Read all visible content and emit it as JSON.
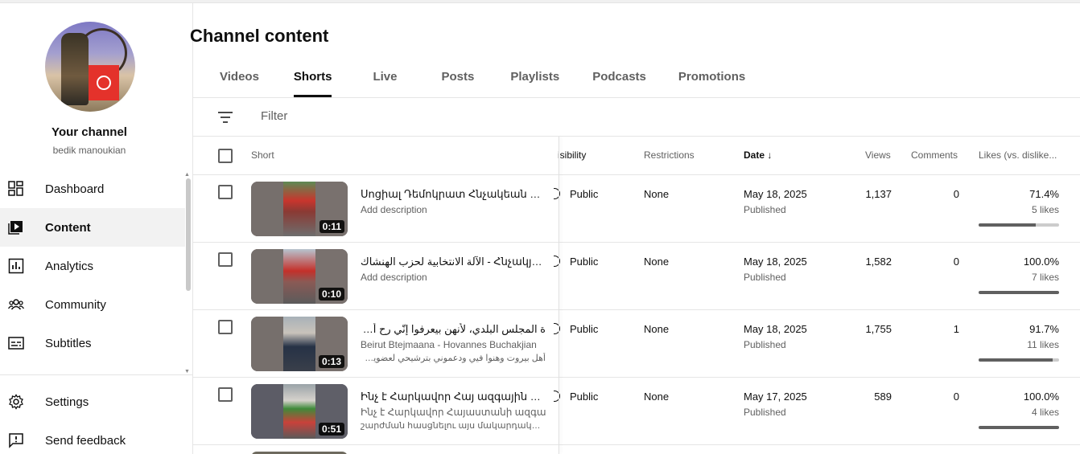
{
  "sidebar": {
    "channel_title": "Your channel",
    "channel_handle": "bedik manoukian",
    "items": [
      {
        "label": "Dashboard",
        "icon": "dashboard-icon"
      },
      {
        "label": "Content",
        "icon": "content-icon",
        "active": true
      },
      {
        "label": "Analytics",
        "icon": "analytics-icon"
      },
      {
        "label": "Community",
        "icon": "community-icon"
      },
      {
        "label": "Subtitles",
        "icon": "subtitles-icon"
      }
    ],
    "bottom_items": [
      {
        "label": "Settings",
        "icon": "gear-icon"
      },
      {
        "label": "Send feedback",
        "icon": "feedback-icon"
      }
    ]
  },
  "main": {
    "title": "Channel content",
    "tabs": [
      {
        "label": "Videos"
      },
      {
        "label": "Shorts",
        "active": true
      },
      {
        "label": "Live"
      },
      {
        "label": "Posts"
      },
      {
        "label": "Playlists"
      },
      {
        "label": "Podcasts"
      },
      {
        "label": "Promotions"
      }
    ],
    "filter_placeholder": "Filter",
    "columns": {
      "short": "Short",
      "visibility": "isibility",
      "restrictions": "Restrictions",
      "date": "Date",
      "date_sort": "↓",
      "views": "Views",
      "comments": "Comments",
      "likes": "Likes (vs. dislike..."
    },
    "rows": [
      {
        "duration": "0:11",
        "title": "Սոցիալ Դեմոկրատ Հնչակեան կուս...",
        "description": "Add description",
        "description2": "",
        "visibility": "Public",
        "restrictions": "None",
        "date": "May 18, 2025",
        "status": "Published",
        "views": "1,137",
        "comments": "0",
        "likes_pct": "71.4%",
        "likes_count": "5 likes",
        "likes_ratio": 0.714
      },
      {
        "duration": "0:10",
        "title": "الآلة الانتخابية لحزب الهنشاك - Հնչակյան կուս...",
        "description": "Add description",
        "description2": "",
        "visibility": "Public",
        "restrictions": "None",
        "date": "May 18, 2025",
        "status": "Published",
        "views": "1,582",
        "comments": "0",
        "likes_pct": "100.0%",
        "likes_count": "7 likes",
        "likes_ratio": 1.0
      },
      {
        "duration": "0:13",
        "title": "ة المجلس البلدي، لأنهن بيعرفوا إنّي رح أوصّل صوتن",
        "description": "Beirut Btejmaana - Hovannes Buchakjian",
        "description2": "أهل بيروت وهنوا فيي ودعموني بترشيحي لعضوية اا...",
        "visibility": "Public",
        "restrictions": "None",
        "date": "May 18, 2025",
        "status": "Published",
        "views": "1,755",
        "comments": "1",
        "likes_pct": "91.7%",
        "likes_count": "11 likes",
        "likes_ratio": 0.917
      },
      {
        "duration": "0:51",
        "title": "Ինչ է Հարկավոր Հայ ազգային շարժ...",
        "description": "Ինչ է Հարկավոր Հայաստանի ազգային",
        "description2": "շարժման հասցնելու այս մակարդակին...",
        "visibility": "Public",
        "restrictions": "None",
        "date": "May 17, 2025",
        "status": "Published",
        "views": "589",
        "comments": "0",
        "likes_pct": "100.0%",
        "likes_count": "4 likes",
        "likes_ratio": 1.0
      }
    ]
  }
}
